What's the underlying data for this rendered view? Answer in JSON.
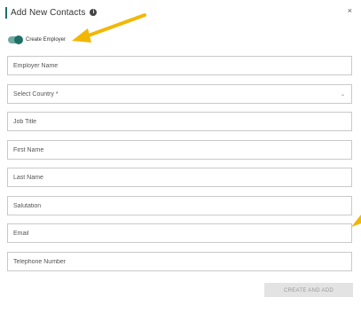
{
  "header": {
    "title": "Add New Contacts",
    "info_icon": "info-icon",
    "close_label": "×"
  },
  "toggle": {
    "label": "Create Employer",
    "checked": true
  },
  "fields": {
    "employer_name": "Employer Name",
    "select_country": "Select Country *",
    "job_title": "Job Title",
    "first_name": "First Name",
    "last_name": "Last Name",
    "salutation": "Salutation",
    "email": "Email",
    "telephone": "Telephone Number"
  },
  "footer": {
    "create_button": "CREATE AND ADD"
  },
  "colors": {
    "accent": "#1f6f66",
    "annotation": "#f2b705"
  }
}
